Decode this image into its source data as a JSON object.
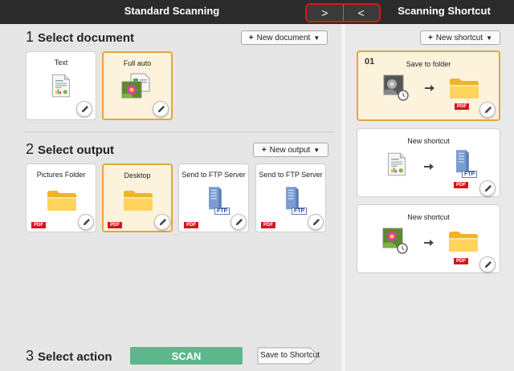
{
  "header": {
    "left_title": "Standard Scanning",
    "right_title": "Scanning Shortcut",
    "nav_next": ">",
    "nav_prev": "<"
  },
  "section1": {
    "num": "1",
    "title": "Select document",
    "new_button": "New document",
    "cards": [
      {
        "label": "Text",
        "selected": false
      },
      {
        "label": "Full auto",
        "selected": true
      }
    ]
  },
  "section2": {
    "num": "2",
    "title": "Select output",
    "new_button": "New output",
    "cards": [
      {
        "label": "Pictures Folder",
        "badge": "PDF",
        "selected": false
      },
      {
        "label": "Desktop",
        "badge": "PDF",
        "selected": true
      },
      {
        "label": "Send to FTP Server",
        "badge": "PDF",
        "icon_label": "FTP",
        "selected": false
      },
      {
        "label": "Send to FTP Server",
        "badge": "PDF",
        "icon_label": "FTP",
        "selected": false
      }
    ]
  },
  "section3": {
    "num": "3",
    "title": "Select action",
    "scan_button": "SCAN",
    "save_shortcut_button": "Save to Shortcut"
  },
  "shortcuts": {
    "new_button": "New shortcut",
    "items": [
      {
        "num": "01",
        "label": "Save to folder",
        "badge": "PDF",
        "selected": true
      },
      {
        "num": "",
        "label": "New shortcut",
        "badge": "PDF",
        "icon_label": "FTP",
        "selected": false
      },
      {
        "num": "",
        "label": "New shortcut",
        "badge": "PDF",
        "selected": false
      }
    ]
  },
  "colors": {
    "header_bg": "#2b2b2b",
    "selected_border": "#e8a33b",
    "selected_bg": "#fdf3dc",
    "scan_green": "#5cb88c",
    "pdf_red": "#d7131b",
    "highlight_red": "#e0131b"
  }
}
